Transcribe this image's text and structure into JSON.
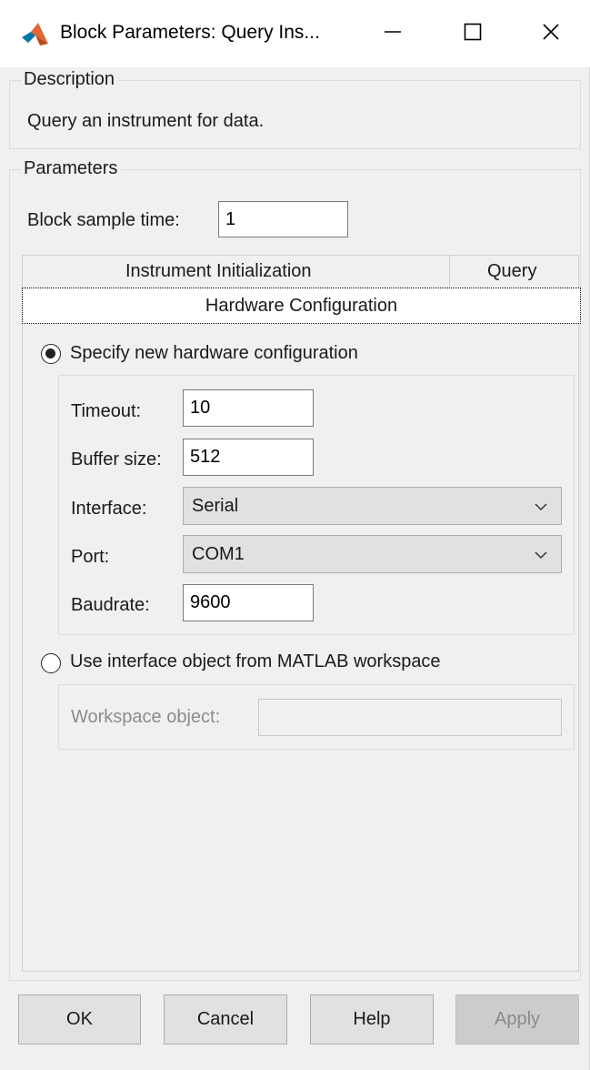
{
  "window": {
    "title": "Block Parameters: Query Ins...",
    "icons": {
      "app": "matlab-logo-icon",
      "minimize": "minimize-icon",
      "maximize": "maximize-icon",
      "close": "close-icon"
    }
  },
  "description": {
    "legend": "Description",
    "text": "Query an instrument for data."
  },
  "parameters": {
    "legend": "Parameters",
    "sample_time": {
      "label": "Block sample time:",
      "value": "1"
    },
    "tabs": [
      {
        "label": "Instrument Initialization"
      },
      {
        "label": "Query"
      },
      {
        "label": "Hardware Configuration",
        "active": true
      }
    ],
    "hardware": {
      "specify_new": {
        "label": "Specify new hardware configuration",
        "checked": true
      },
      "timeout": {
        "label": "Timeout:",
        "value": "10"
      },
      "buffer_size": {
        "label": "Buffer size:",
        "value": "512"
      },
      "interface": {
        "label": "Interface:",
        "value": "Serial"
      },
      "port": {
        "label": "Port:",
        "value": "COM1"
      },
      "baudrate": {
        "label": "Baudrate:",
        "value": "9600"
      },
      "use_workspace": {
        "label": "Use interface object from MATLAB workspace",
        "checked": false
      },
      "workspace_object": {
        "label": "Workspace object:",
        "value": ""
      }
    }
  },
  "buttons": {
    "ok": "OK",
    "cancel": "Cancel",
    "help": "Help",
    "apply": "Apply"
  },
  "colors": {
    "window_bg": "#f0f0f0",
    "titlebar_bg": "#ffffff",
    "button_bg": "#e1e1e1",
    "disabled_button_bg": "#cccccc",
    "logo_orange": "#e16737",
    "logo_blue": "#0076a8"
  }
}
